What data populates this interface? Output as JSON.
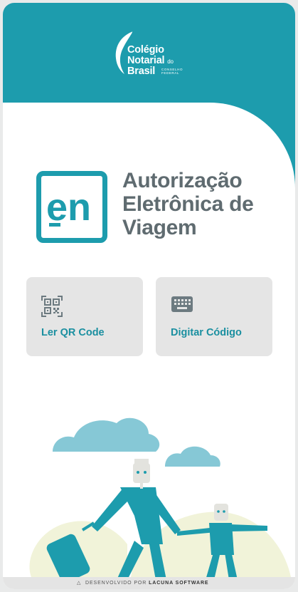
{
  "header": {
    "logo": {
      "line1": "Colégio",
      "line2": "Notarial",
      "line2_small": "do",
      "line3": "Brasil",
      "sub_line1": "CONSELHO",
      "sub_line2": "FEDERAL"
    }
  },
  "app": {
    "logo_text": "en",
    "title_lines": [
      "Autorização",
      "Eletrônica de",
      "Viagem"
    ]
  },
  "actions": {
    "qr": {
      "label": "Ler QR Code",
      "icon": "qr-code-icon"
    },
    "code": {
      "label": "Digitar Código",
      "icon": "keyboard-icon"
    }
  },
  "footer": {
    "prefix": "DESENVOLVIDO POR",
    "brand": "LACUNA SOFTWARE",
    "icon": "lacuna-icon"
  },
  "colors": {
    "primary": "#1d9cad",
    "title_gray": "#5f6b70",
    "button_bg": "#e5e5e5",
    "cloud": "#86c8d6",
    "hill": "#f1f3d9"
  }
}
